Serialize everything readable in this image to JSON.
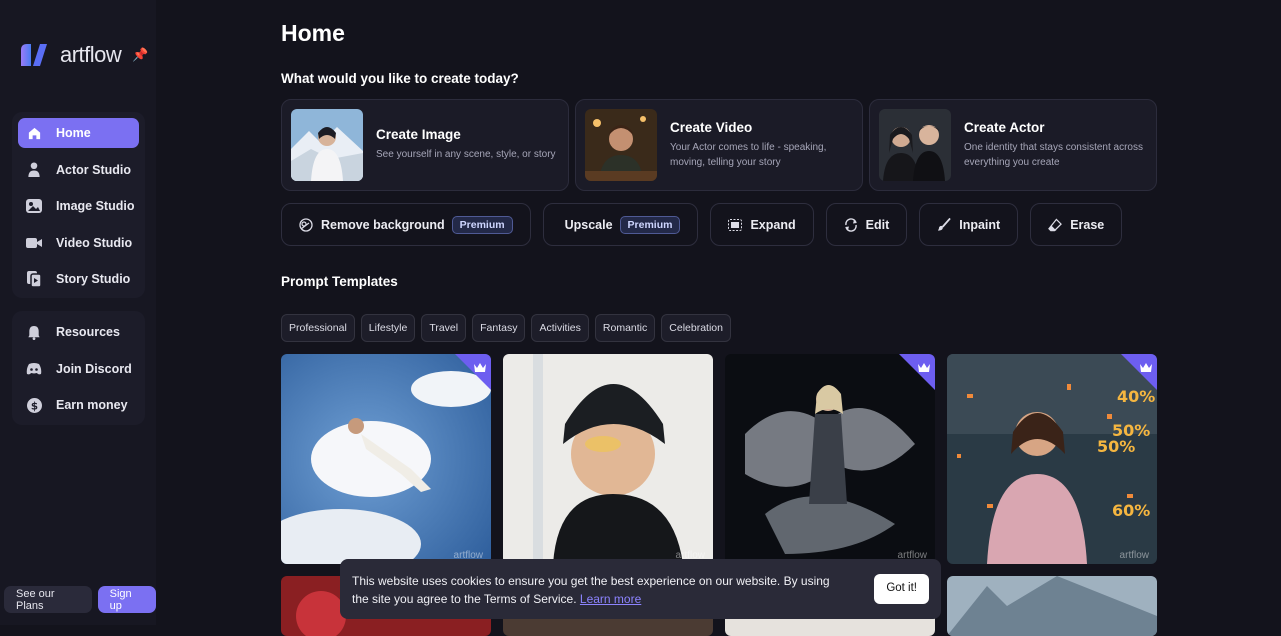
{
  "brand": {
    "name": "artflow",
    "accent": "#7b70f2"
  },
  "sidebar": {
    "primary": [
      {
        "label": "Home",
        "icon": "home-icon",
        "active": true
      },
      {
        "label": "Actor Studio",
        "icon": "person-icon"
      },
      {
        "label": "Image Studio",
        "icon": "image-icon"
      },
      {
        "label": "Video Studio",
        "icon": "video-icon"
      },
      {
        "label": "Story Studio",
        "icon": "story-icon"
      }
    ],
    "secondary": [
      {
        "label": "Resources",
        "icon": "bell-icon"
      },
      {
        "label": "Join Discord",
        "icon": "discord-icon"
      },
      {
        "label": "Earn money",
        "icon": "dollar-icon"
      }
    ],
    "plans_label": "See our Plans",
    "signup_label": "Sign up"
  },
  "main": {
    "title": "Home",
    "subtitle": "What would you like to create today?",
    "create_cards": [
      {
        "title": "Create Image",
        "desc": "See yourself in any scene, style, or story"
      },
      {
        "title": "Create Video",
        "desc": "Your Actor comes to life - speaking, moving, telling your story"
      },
      {
        "title": "Create Actor",
        "desc": "One identity that stays consistent across everything you create"
      }
    ],
    "tools": [
      {
        "label": "Remove background",
        "badge": "Premium",
        "icon": "remove-bg-icon"
      },
      {
        "label": "Upscale",
        "badge": "Premium",
        "icon": "upscale-icon"
      },
      {
        "label": "Expand",
        "icon": "expand-icon"
      },
      {
        "label": "Edit",
        "icon": "edit-icon"
      },
      {
        "label": "Inpaint",
        "icon": "brush-icon"
      },
      {
        "label": "Erase",
        "icon": "eraser-icon"
      }
    ],
    "templates_title": "Prompt Templates",
    "filters": [
      "Professional",
      "Lifestyle",
      "Travel",
      "Fantasy",
      "Activities",
      "Romantic",
      "Celebration"
    ],
    "watermark": "artflow"
  },
  "cookie": {
    "text": "This website uses cookies to ensure you get the best experience on our website. By using the site you agree to the Terms of Service.",
    "link": "Learn more",
    "button": "Got it!"
  }
}
